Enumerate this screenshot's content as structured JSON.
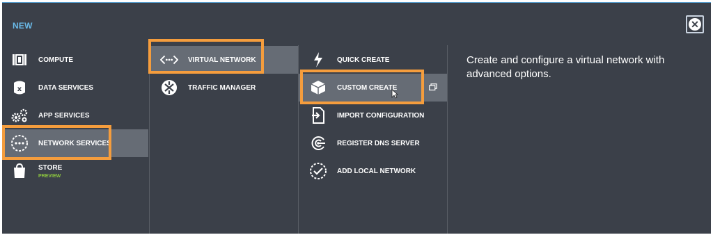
{
  "dialog": {
    "title": "NEW",
    "close_label": "✕"
  },
  "categories": [
    {
      "label": "COMPUTE",
      "icon": "compute-icon"
    },
    {
      "label": "DATA SERVICES",
      "icon": "database-icon"
    },
    {
      "label": "APP SERVICES",
      "icon": "gears-icon"
    },
    {
      "label": "NETWORK SERVICES",
      "icon": "network-icon",
      "selected": true
    },
    {
      "label": "STORE",
      "sublabel": "PREVIEW",
      "icon": "shopping-bag-icon"
    }
  ],
  "network_items": [
    {
      "label": "VIRTUAL NETWORK",
      "icon": "virtual-network-icon",
      "selected": true
    },
    {
      "label": "TRAFFIC MANAGER",
      "icon": "traffic-manager-icon"
    }
  ],
  "actions": [
    {
      "label": "QUICK CREATE",
      "icon": "lightning-icon"
    },
    {
      "label": "CUSTOM CREATE",
      "icon": "box-icon",
      "selected": true
    },
    {
      "label": "IMPORT CONFIGURATION",
      "icon": "import-icon"
    },
    {
      "label": "REGISTER DNS SERVER",
      "icon": "dns-icon"
    },
    {
      "label": "ADD LOCAL NETWORK",
      "icon": "check-circle-icon"
    }
  ],
  "description": "Create and configure a virtual network with advanced options.",
  "colors": {
    "panel": "#3b4049",
    "selected": "#666c75",
    "highlight": "#f59d3d",
    "title": "#69b8e6",
    "preview": "#8cc63f"
  }
}
